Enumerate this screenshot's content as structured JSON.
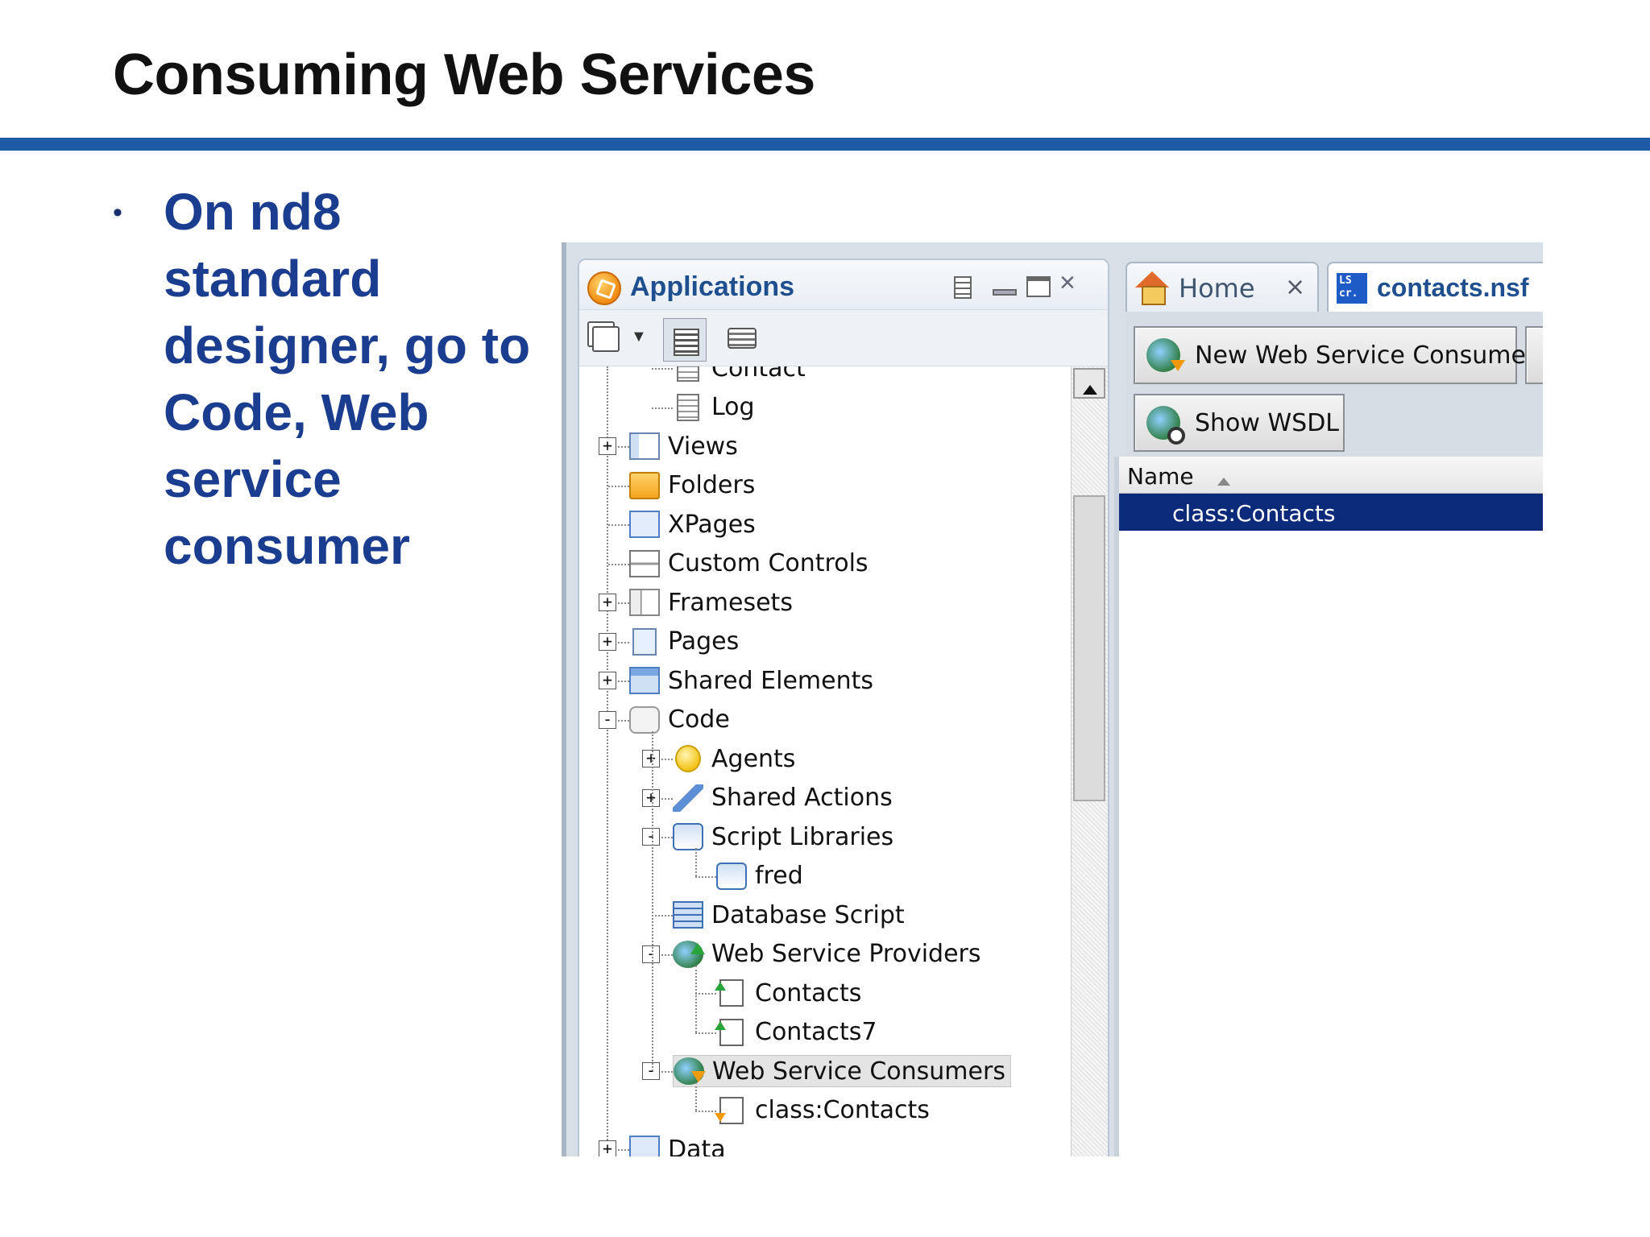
{
  "slide": {
    "title": "Consuming Web Services",
    "bullet": "On nd8 standard\ndesigner, go to\nCode, Web service\nconsumer"
  },
  "applications_panel": {
    "title": "Applications",
    "tree": [
      {
        "label": "Contact",
        "depth": 1,
        "icon": "document-icon",
        "expander": null
      },
      {
        "label": "Log",
        "depth": 1,
        "icon": "document-icon",
        "expander": null
      },
      {
        "label": "Views",
        "depth": 0,
        "icon": "view-icon",
        "expander": "+"
      },
      {
        "label": "Folders",
        "depth": 0,
        "icon": "folder-icon",
        "expander": null
      },
      {
        "label": "XPages",
        "depth": 0,
        "icon": "xpage-icon",
        "expander": null
      },
      {
        "label": "Custom Controls",
        "depth": 0,
        "icon": "custom-control-icon",
        "expander": null
      },
      {
        "label": "Framesets",
        "depth": 0,
        "icon": "frameset-icon",
        "expander": "+"
      },
      {
        "label": "Pages",
        "depth": 0,
        "icon": "page-icon",
        "expander": "+"
      },
      {
        "label": "Shared Elements",
        "depth": 0,
        "icon": "shared-elements-icon",
        "expander": "+"
      },
      {
        "label": "Code",
        "depth": 0,
        "icon": "code-icon",
        "expander": "−"
      },
      {
        "label": "Agents",
        "depth": 1,
        "icon": "agent-icon",
        "expander": "+"
      },
      {
        "label": "Shared Actions",
        "depth": 1,
        "icon": "shared-action-icon",
        "expander": "+"
      },
      {
        "label": "Script Libraries",
        "depth": 1,
        "icon": "script-library-icon",
        "expander": "−"
      },
      {
        "label": "fred",
        "depth": 2,
        "icon": "script-library-icon",
        "expander": null
      },
      {
        "label": "Database Script",
        "depth": 1,
        "icon": "database-script-icon",
        "expander": null
      },
      {
        "label": "Web Service Providers",
        "depth": 1,
        "icon": "web-service-provider-icon",
        "expander": "−"
      },
      {
        "label": "Contacts",
        "depth": 2,
        "icon": "provider-item-icon",
        "expander": null
      },
      {
        "label": "Contacts7",
        "depth": 2,
        "icon": "provider-item-icon",
        "expander": null
      },
      {
        "label": "Web Service Consumers",
        "depth": 1,
        "icon": "web-service-consumer-icon",
        "expander": "−",
        "selected": true
      },
      {
        "label": "class:Contacts",
        "depth": 2,
        "icon": "consumer-item-icon",
        "expander": null
      },
      {
        "label": "Data",
        "depth": 0,
        "icon": "data-icon",
        "expander": "+"
      }
    ]
  },
  "tabs": [
    {
      "label": "Home",
      "icon": "house-icon"
    },
    {
      "label": "contacts.nsf",
      "icon": "ls-icon",
      "icon_text": "LS\ncr."
    }
  ],
  "actions": {
    "new_consumer": "New Web Service Consumer",
    "show_wsdl": "Show WSDL"
  },
  "grid": {
    "column": "Name",
    "rows": [
      "class:Contacts"
    ]
  },
  "colors": {
    "title_rule": "#1f5aa5",
    "bullet_text": "#1b3d8f",
    "selected_row": "#0c2a7a"
  }
}
